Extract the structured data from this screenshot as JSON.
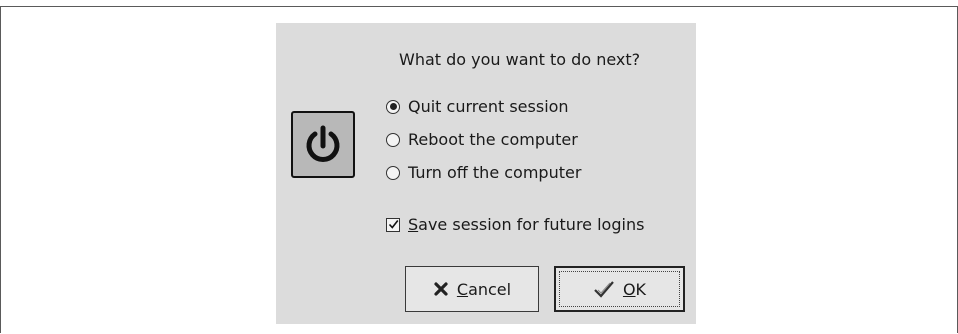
{
  "dialog": {
    "prompt": "What do you want to do next?",
    "options": [
      {
        "label": "Quit current session",
        "selected": true
      },
      {
        "label": "Reboot the computer",
        "selected": false
      },
      {
        "label": "Turn off the computer",
        "selected": false
      }
    ],
    "save_session": {
      "mnemonic": "S",
      "label_rest": "ave session for future logins",
      "checked": true
    },
    "buttons": {
      "cancel": {
        "mnemonic": "C",
        "label_rest": "ancel",
        "icon": "cancel-x-icon"
      },
      "ok": {
        "mnemonic": "O",
        "label_rest": "K",
        "icon": "checkmark-icon"
      }
    },
    "main_icon": "power-icon"
  }
}
